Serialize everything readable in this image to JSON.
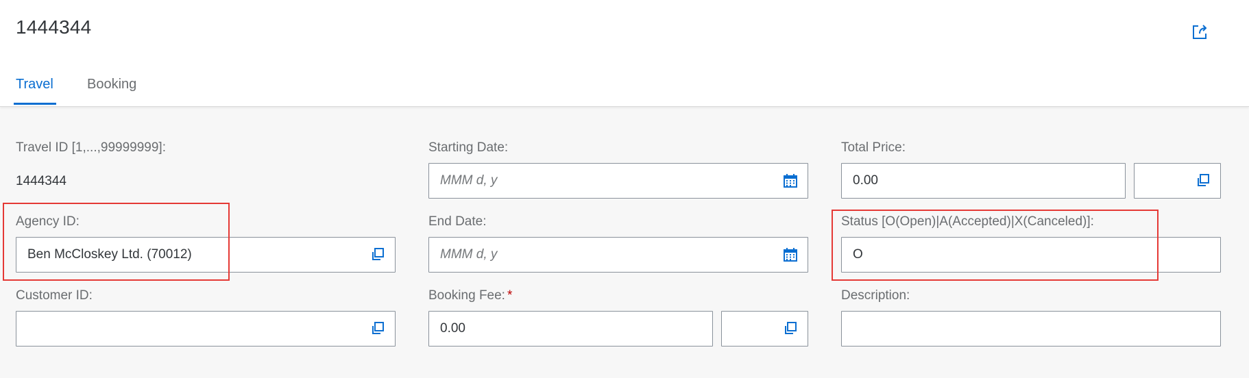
{
  "header": {
    "title": "1444344",
    "share_icon": "share-icon"
  },
  "tabs": [
    {
      "label": "Travel",
      "active": true
    },
    {
      "label": "Booking",
      "active": false
    }
  ],
  "form": {
    "travel_id": {
      "label": "Travel ID [1,...,99999999]:",
      "value": "1444344"
    },
    "agency_id": {
      "label": "Agency ID:",
      "value": "Ben McCloskey Ltd. (70012)",
      "icon": "value-help-icon"
    },
    "customer_id": {
      "label": "Customer ID:",
      "value": "",
      "icon": "value-help-icon"
    },
    "starting_date": {
      "label": "Starting Date:",
      "placeholder": "MMM d, y",
      "icon": "calendar-icon"
    },
    "end_date": {
      "label": "End Date:",
      "placeholder": "MMM d, y",
      "icon": "calendar-icon"
    },
    "booking_fee": {
      "label": "Booking Fee:",
      "required_marker": "*",
      "value": "0.00",
      "currency": "",
      "icon": "value-help-icon"
    },
    "total_price": {
      "label": "Total Price:",
      "value": "0.00",
      "currency": "",
      "icon": "value-help-icon"
    },
    "status": {
      "label": "Status [O(Open)|A(Accepted)|X(Canceled)]:",
      "value": "O"
    },
    "description": {
      "label": "Description:",
      "value": ""
    }
  },
  "colors": {
    "accent": "#0a6ed1",
    "highlight": "#e53935",
    "required": "#bb0000"
  }
}
